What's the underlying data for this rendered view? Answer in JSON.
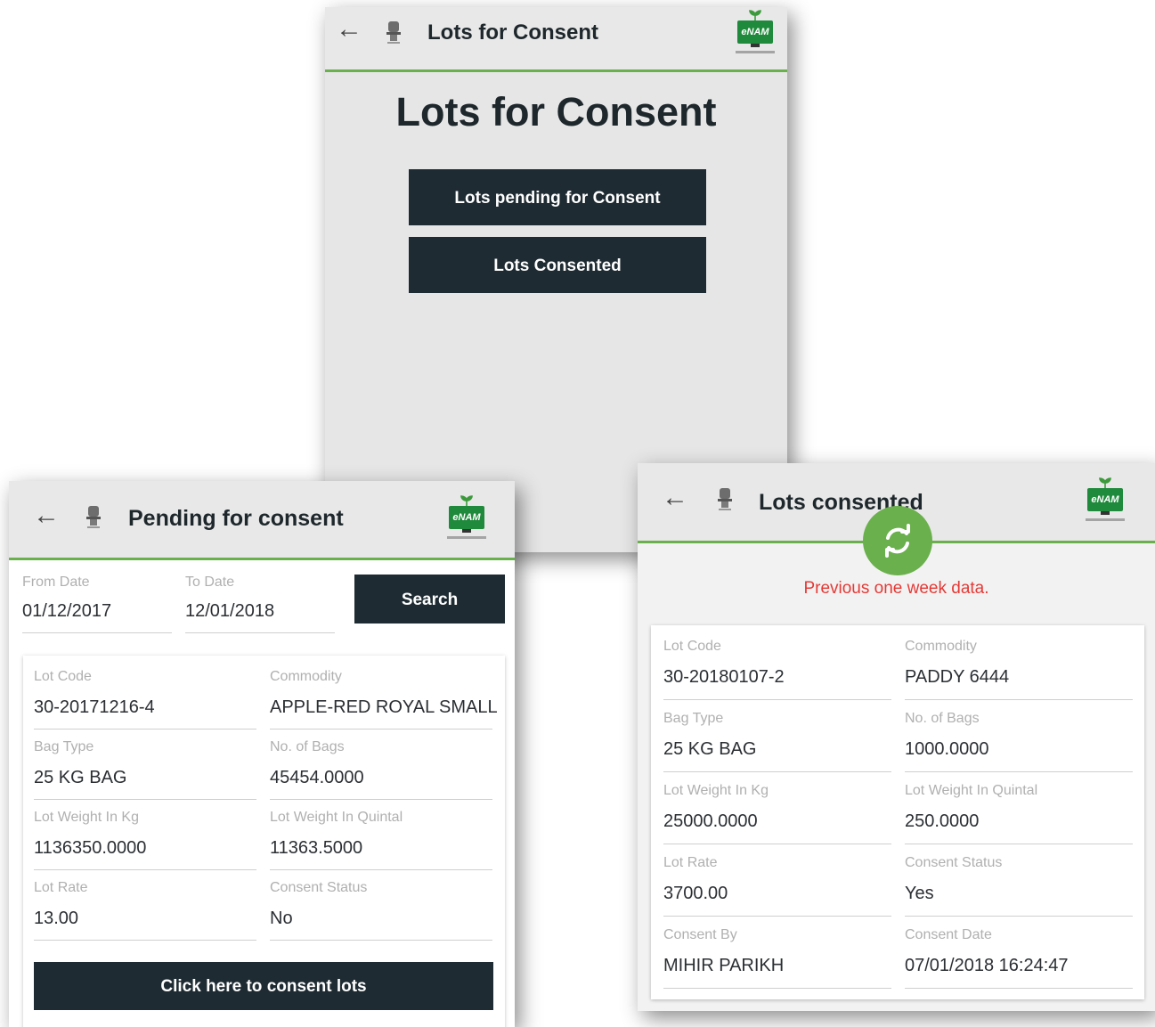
{
  "screens": {
    "main": {
      "appbar_title": "Lots for Consent",
      "heading": "Lots for Consent",
      "buttons": [
        "Lots pending for Consent",
        "Lots Consented"
      ]
    },
    "pending": {
      "appbar_title": "Pending for consent",
      "from_date_label": "From Date",
      "from_date_value": "01/12/2017",
      "to_date_label": "To Date",
      "to_date_value": "12/01/2018",
      "search_label": "Search",
      "fields": [
        {
          "label": "Lot Code",
          "value": "30-20171216-4"
        },
        {
          "label": "Commodity",
          "value": "APPLE-RED ROYAL  SMALL"
        },
        {
          "label": "Bag Type",
          "value": "25 KG BAG"
        },
        {
          "label": "No. of Bags",
          "value": "45454.0000"
        },
        {
          "label": "Lot Weight In Kg",
          "value": "1136350.0000"
        },
        {
          "label": "Lot Weight In Quintal",
          "value": "11363.5000"
        },
        {
          "label": "Lot Rate",
          "value": "13.00"
        },
        {
          "label": "Consent Status",
          "value": "No"
        }
      ],
      "consent_button": "Click here to consent lots"
    },
    "consented": {
      "appbar_title": "Lots consented",
      "notice": "Previous one week data.",
      "fields": [
        {
          "label": "Lot Code",
          "value": "30-20180107-2"
        },
        {
          "label": "Commodity",
          "value": "PADDY 6444"
        },
        {
          "label": "Bag Type",
          "value": "25 KG BAG"
        },
        {
          "label": "No. of Bags",
          "value": "1000.0000"
        },
        {
          "label": "Lot Weight In Kg",
          "value": "25000.0000"
        },
        {
          "label": "Lot Weight In Quintal",
          "value": "250.0000"
        },
        {
          "label": "Lot Rate",
          "value": "3700.00"
        },
        {
          "label": "Consent Status",
          "value": "Yes"
        },
        {
          "label": "Consent By",
          "value": "MIHIR PARIKH"
        },
        {
          "label": "Consent Date",
          "value": "07/01/2018 16:24:47"
        }
      ]
    }
  },
  "logo_text": "eNAM",
  "colors": {
    "accent_green": "#6ab04c",
    "dark_button": "#1e2b32",
    "notice_red": "#e53935"
  }
}
